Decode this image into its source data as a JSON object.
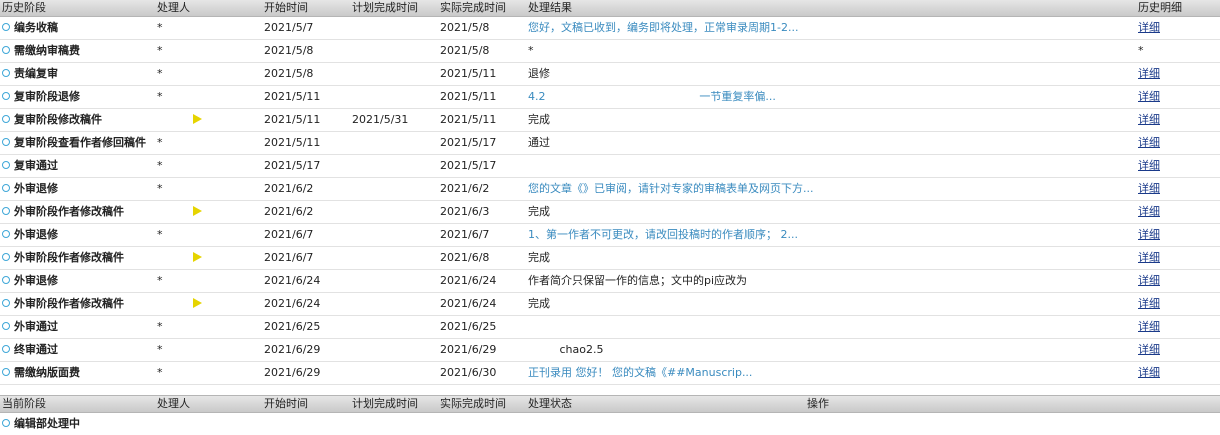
{
  "history": {
    "columns": {
      "stage": "历史阶段",
      "handler": "处理人",
      "start": "开始时间",
      "plan": "计划完成时间",
      "actual": "实际完成时间",
      "result": "处理结果",
      "hist": "历史明细"
    },
    "rows": [
      {
        "stage": "编务收稿",
        "handler": "*",
        "start": "2021/5/7",
        "plan": "",
        "actual": "2021/5/8",
        "result": "您好，文稿已收到，编务即将处理，正常审录周期1-2...",
        "result_link": true,
        "hist": "详细",
        "hist_link": true,
        "flag": false
      },
      {
        "stage": "需缴纳审稿费",
        "handler": "*",
        "start": "2021/5/8",
        "plan": "",
        "actual": "2021/5/8",
        "result": "*",
        "result_link": false,
        "hist": "*",
        "hist_link": false,
        "flag": false
      },
      {
        "stage": "责编复审",
        "handler": "*",
        "start": "2021/5/8",
        "plan": "",
        "actual": "2021/5/11",
        "result": "退修",
        "result_link": false,
        "hist": "详细",
        "hist_link": true,
        "flag": false
      },
      {
        "stage": "复审阶段退修",
        "handler": "*",
        "start": "2021/5/11",
        "plan": "",
        "actual": "2021/5/11",
        "result": "4.2                                            一节重复率偏...",
        "result_link": true,
        "hist": "详细",
        "hist_link": true,
        "flag": false
      },
      {
        "stage": "复审阶段修改稿件",
        "handler": "",
        "start": "2021/5/11",
        "plan": "2021/5/31",
        "actual": "2021/5/11",
        "result": "完成",
        "result_link": false,
        "hist": "详细",
        "hist_link": true,
        "flag": true
      },
      {
        "stage": "复审阶段查看作者修回稿件",
        "handler": "*",
        "start": "2021/5/11",
        "plan": "",
        "actual": "2021/5/17",
        "result": "通过",
        "result_link": false,
        "hist": "详细",
        "hist_link": true,
        "flag": false
      },
      {
        "stage": "复审通过",
        "handler": "*",
        "start": "2021/5/17",
        "plan": "",
        "actual": "2021/5/17",
        "result": "",
        "result_link": false,
        "hist": "详细",
        "hist_link": true,
        "flag": false
      },
      {
        "stage": "外审退修",
        "handler": "*",
        "start": "2021/6/2",
        "plan": "",
        "actual": "2021/6/2",
        "result": "您的文章《》已审阅，请针对专家的审稿表单及网页下方...",
        "result_link": true,
        "hist": "详细",
        "hist_link": true,
        "flag": false
      },
      {
        "stage": "外审阶段作者修改稿件",
        "handler": "",
        "start": "2021/6/2",
        "plan": "",
        "actual": "2021/6/3",
        "result": "完成",
        "result_link": false,
        "hist": "详细",
        "hist_link": true,
        "flag": true
      },
      {
        "stage": "外审退修",
        "handler": "*",
        "start": "2021/6/7",
        "plan": "",
        "actual": "2021/6/7",
        "result": "1、第一作者不可更改，请改回投稿时的作者顺序； 2...",
        "result_link": true,
        "hist": "详细",
        "hist_link": true,
        "flag": false
      },
      {
        "stage": "外审阶段作者修改稿件",
        "handler": "",
        "start": "2021/6/7",
        "plan": "",
        "actual": "2021/6/8",
        "result": "完成",
        "result_link": false,
        "hist": "详细",
        "hist_link": true,
        "flag": true
      },
      {
        "stage": "外审退修",
        "handler": "*",
        "start": "2021/6/24",
        "plan": "",
        "actual": "2021/6/24",
        "result": "作者简介只保留一作的信息；文中的pi应改为",
        "result_link": false,
        "hist": "详细",
        "hist_link": true,
        "flag": false
      },
      {
        "stage": "外审阶段作者修改稿件",
        "handler": "",
        "start": "2021/6/24",
        "plan": "",
        "actual": "2021/6/24",
        "result": "完成",
        "result_link": false,
        "hist": "详细",
        "hist_link": true,
        "flag": true
      },
      {
        "stage": "外审通过",
        "handler": "*",
        "start": "2021/6/25",
        "plan": "",
        "actual": "2021/6/25",
        "result": "",
        "result_link": false,
        "hist": "详细",
        "hist_link": true,
        "flag": false
      },
      {
        "stage": "终审通过",
        "handler": "*",
        "start": "2021/6/29",
        "plan": "",
        "actual": "2021/6/29",
        "result": "         chao2.5",
        "result_link": false,
        "hist": "详细",
        "hist_link": true,
        "flag": false
      },
      {
        "stage": "需缴纳版面费",
        "handler": "*",
        "start": "2021/6/29",
        "plan": "",
        "actual": "2021/6/30",
        "result": "正刊录用 您好！ 您的文稿《##Manuscrip...",
        "result_link": true,
        "hist": "详细",
        "hist_link": true,
        "flag": false
      }
    ]
  },
  "current": {
    "columns": {
      "stage": "当前阶段",
      "handler": "处理人",
      "start": "开始时间",
      "plan": "计划完成时间",
      "actual": "实际完成时间",
      "status": "处理状态",
      "op": "操作"
    },
    "rows": [
      {
        "stage": "编辑部处理中"
      }
    ]
  },
  "colors": {
    "link": "#3a8bbf",
    "detail": "#1a3a8a",
    "bullet": "#3fa7d8",
    "flag": "#e6d400"
  }
}
